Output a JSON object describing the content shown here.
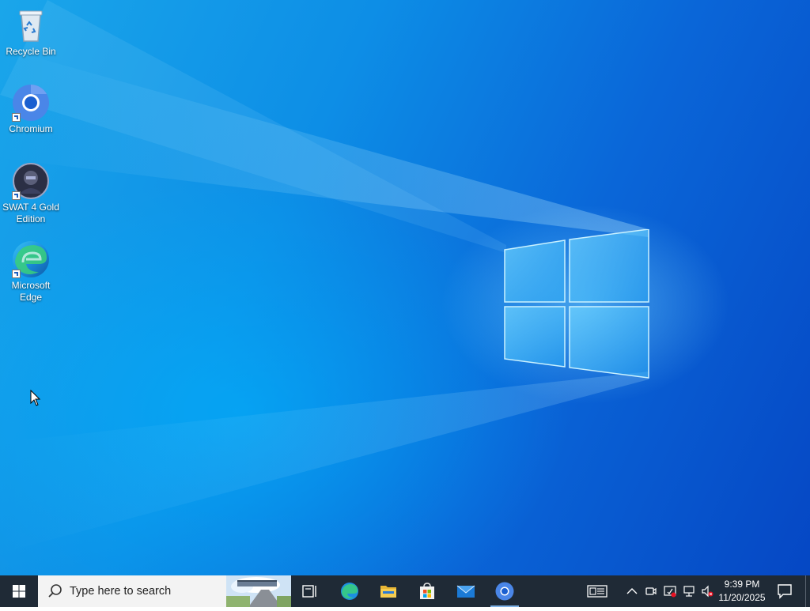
{
  "desktop": {
    "icons": [
      {
        "label": "Recycle Bin",
        "icon": "recycle-bin-icon"
      },
      {
        "label": "Chromium",
        "icon": "chromium-icon"
      },
      {
        "label": "SWAT 4 Gold Edition",
        "icon": "swat4-icon"
      },
      {
        "label": "Microsoft Edge",
        "icon": "edge-icon"
      }
    ]
  },
  "taskbar": {
    "search_placeholder": "Type here to search",
    "pinned": [
      {
        "name": "Task View",
        "icon": "task-view-icon"
      },
      {
        "name": "Microsoft Edge",
        "icon": "edge-icon"
      },
      {
        "name": "File Explorer",
        "icon": "folder-icon"
      },
      {
        "name": "Microsoft Store",
        "icon": "store-icon"
      },
      {
        "name": "Mail",
        "icon": "mail-icon"
      },
      {
        "name": "Chromium",
        "icon": "chromium-icon"
      }
    ],
    "tray": {
      "icons": [
        "news-widget-icon",
        "chevron-up-icon",
        "meet-now-icon",
        "security-icon",
        "network-icon",
        "volume-muted-icon"
      ],
      "time": "9:39 PM",
      "date": "11/20/2025"
    }
  },
  "colors": {
    "wallpaper_start": "#1aa6ea",
    "wallpaper_end": "#0547c4",
    "taskbar": "#1f2a36",
    "search_box": "#f3f3f3"
  }
}
